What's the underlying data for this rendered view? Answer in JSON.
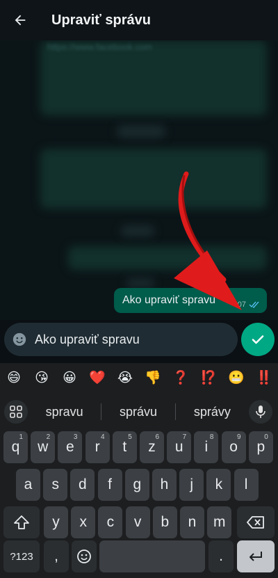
{
  "header": {
    "title": "Upraviť správu"
  },
  "chat": {
    "blurred_link": "https://www.facebook.com",
    "message": {
      "text": "Ako upraviť spravu",
      "time": "07"
    }
  },
  "editor": {
    "value": "Ako upraviť spravu"
  },
  "emoji_suggestions": [
    "😄",
    "😘",
    "😀",
    "❤️",
    "😭",
    "👎",
    "❓",
    "⁉️",
    "😬",
    "‼️"
  ],
  "keyboard": {
    "suggestions": [
      "spravu",
      "správu",
      "správy"
    ],
    "row1": [
      {
        "k": "q",
        "s": "1"
      },
      {
        "k": "w",
        "s": "2"
      },
      {
        "k": "e",
        "s": "3"
      },
      {
        "k": "r",
        "s": "4"
      },
      {
        "k": "t",
        "s": "5"
      },
      {
        "k": "z",
        "s": "6"
      },
      {
        "k": "u",
        "s": "7"
      },
      {
        "k": "i",
        "s": "8"
      },
      {
        "k": "o",
        "s": "9"
      },
      {
        "k": "p",
        "s": "0"
      }
    ],
    "row2": [
      "a",
      "s",
      "d",
      "f",
      "g",
      "h",
      "j",
      "k",
      "l"
    ],
    "row3": [
      "y",
      "x",
      "c",
      "v",
      "b",
      "n",
      "m"
    ],
    "symbols_label": "?123",
    "comma": ",",
    "period": "."
  },
  "colors": {
    "accent": "#00a884",
    "bubble": "#005c4b",
    "arrow": "#e01b1b"
  },
  "icons": [
    "back-arrow-icon",
    "emoji-icon",
    "check-icon",
    "apps-grid-icon",
    "mic-icon",
    "shift-icon",
    "backspace-icon",
    "smiley-icon",
    "enter-icon"
  ]
}
